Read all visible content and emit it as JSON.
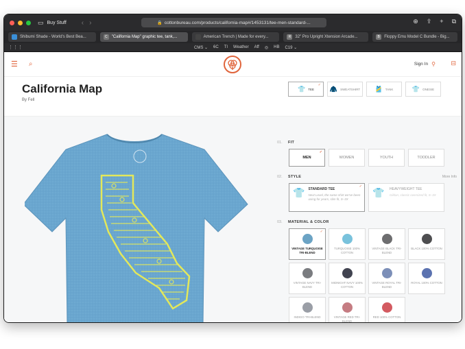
{
  "browser": {
    "window_title": "Buy Stuff",
    "url": "cottonbureau.com/products/california-map#/1453131/tee-men-standard-...",
    "tabs": [
      {
        "label": "Shibumi Shade - World's Best Bea...",
        "favicon": ""
      },
      {
        "label": "\"California Map\" graphic tee, tank,...",
        "favicon": "C"
      },
      {
        "label": "American Trench | Made for every...",
        "favicon": ""
      },
      {
        "label": "32\" Pro Upright Xtension Arcade...",
        "favicon": "R"
      },
      {
        "label": "Floppy Emu Model C Bundle - Big...",
        "favicon": "B"
      }
    ],
    "bookmarks": [
      "CMS ⌄",
      "6C",
      "TI",
      "Weather",
      "Aff",
      "◎",
      "HB",
      "C19 ⌄"
    ]
  },
  "site": {
    "signin_label": "Sign In",
    "accent": "#e0643b"
  },
  "product": {
    "title": "California Map",
    "by": "By Fell",
    "types": [
      {
        "label": "TEE",
        "selected": true
      },
      {
        "label": "SWEATSHIRT",
        "selected": false
      },
      {
        "label": "TANK",
        "selected": false
      },
      {
        "label": "ONESIE",
        "selected": false
      }
    ],
    "tee_color": "#6aa6cf",
    "print_color": "#e3e85a"
  },
  "options": {
    "fit": {
      "num": "01.",
      "title": "FIT",
      "choices": [
        "MEN",
        "WOMEN",
        "YOUTH",
        "TODDLER"
      ],
      "selected": "MEN"
    },
    "style": {
      "num": "02.",
      "title": "STYLE",
      "more": "More Info",
      "choices": [
        {
          "name": "STANDARD TEE",
          "desc": "Next Level, the same shirt we've been using for years, slim fit, S–3X",
          "selected": true
        },
        {
          "name": "HEAVYWEIGHT TEE",
          "desc": "Gildan, classic oversized fit, S–3X",
          "selected": false
        }
      ]
    },
    "color": {
      "num": "03.",
      "title": "MATERIAL & COLOR",
      "choices": [
        {
          "label": "VINTAGE TURQUOISE TRI-BLEND",
          "hex": "#6ba3c4",
          "selected": true
        },
        {
          "label": "TURQUOISE 100% COTTON",
          "hex": "#79c2dc",
          "selected": false
        },
        {
          "label": "VINTAGE BLACK TRI-BLEND",
          "hex": "#6d6d6f",
          "selected": false
        },
        {
          "label": "BLACK 100% COTTON",
          "hex": "#4e4e50",
          "selected": false
        },
        {
          "label": "VINTAGE NAVY TRI-BLEND",
          "hex": "#7a7c80",
          "selected": false
        },
        {
          "label": "MIDNIGHT NAVY 100% COTTON",
          "hex": "#414350",
          "selected": false
        },
        {
          "label": "VINTAGE ROYAL TRI-BLEND",
          "hex": "#7c8fb8",
          "selected": false
        },
        {
          "label": "ROYAL 100% COTTON",
          "hex": "#5b72b0",
          "selected": false
        },
        {
          "label": "INDIGO TRI-BLEND",
          "hex": "#9a9ea6",
          "selected": false
        },
        {
          "label": "VINTAGE RED TRI-BLEND",
          "hex": "#c57c82",
          "selected": false
        },
        {
          "label": "RED 100% COTTON",
          "hex": "#d35a60",
          "selected": false
        }
      ]
    }
  }
}
